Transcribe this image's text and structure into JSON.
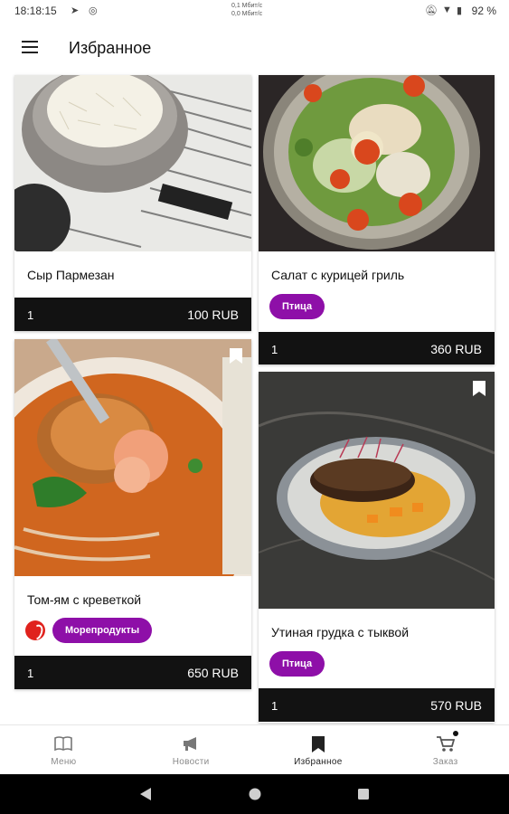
{
  "status_bar": {
    "time": "18:18:15",
    "net_up": "0,1 Мбит/с",
    "net_down": "0,0 Мбит/с",
    "battery": "92 %"
  },
  "app_bar": {
    "title": "Избранное",
    "menu_icon": "hamburger-menu-icon"
  },
  "cards": [
    {
      "name": "Сыр Пармезан",
      "qty": "1",
      "price": "100 RUB",
      "tags": [],
      "image": "parmesan-bowl"
    },
    {
      "name": "Салат с курицей гриль",
      "qty": "1",
      "price": "360 RUB",
      "tags": [
        "Птица"
      ],
      "image": "chicken-salad"
    },
    {
      "name": "Том-ям с креветкой",
      "qty": "1",
      "price": "650 RUB",
      "tags": [
        "Морепродукты"
      ],
      "spicy": true,
      "image": "tom-yum-shrimp"
    },
    {
      "name": "Утиная грудка с тыквой",
      "qty": "1",
      "price": "570 RUB",
      "tags": [
        "Птица"
      ],
      "image": "duck-breast-pumpkin"
    }
  ],
  "bottom_nav": [
    {
      "label": "Меню",
      "icon": "book-icon"
    },
    {
      "label": "Новости",
      "icon": "megaphone-icon"
    },
    {
      "label": "Избранное",
      "icon": "bookmark-icon",
      "active": true
    },
    {
      "label": "Заказ",
      "icon": "cart-icon",
      "badge": true
    }
  ],
  "colors": {
    "accent": "#8e0fa8",
    "price_bar": "#121212",
    "spicy": "#e0221d"
  }
}
